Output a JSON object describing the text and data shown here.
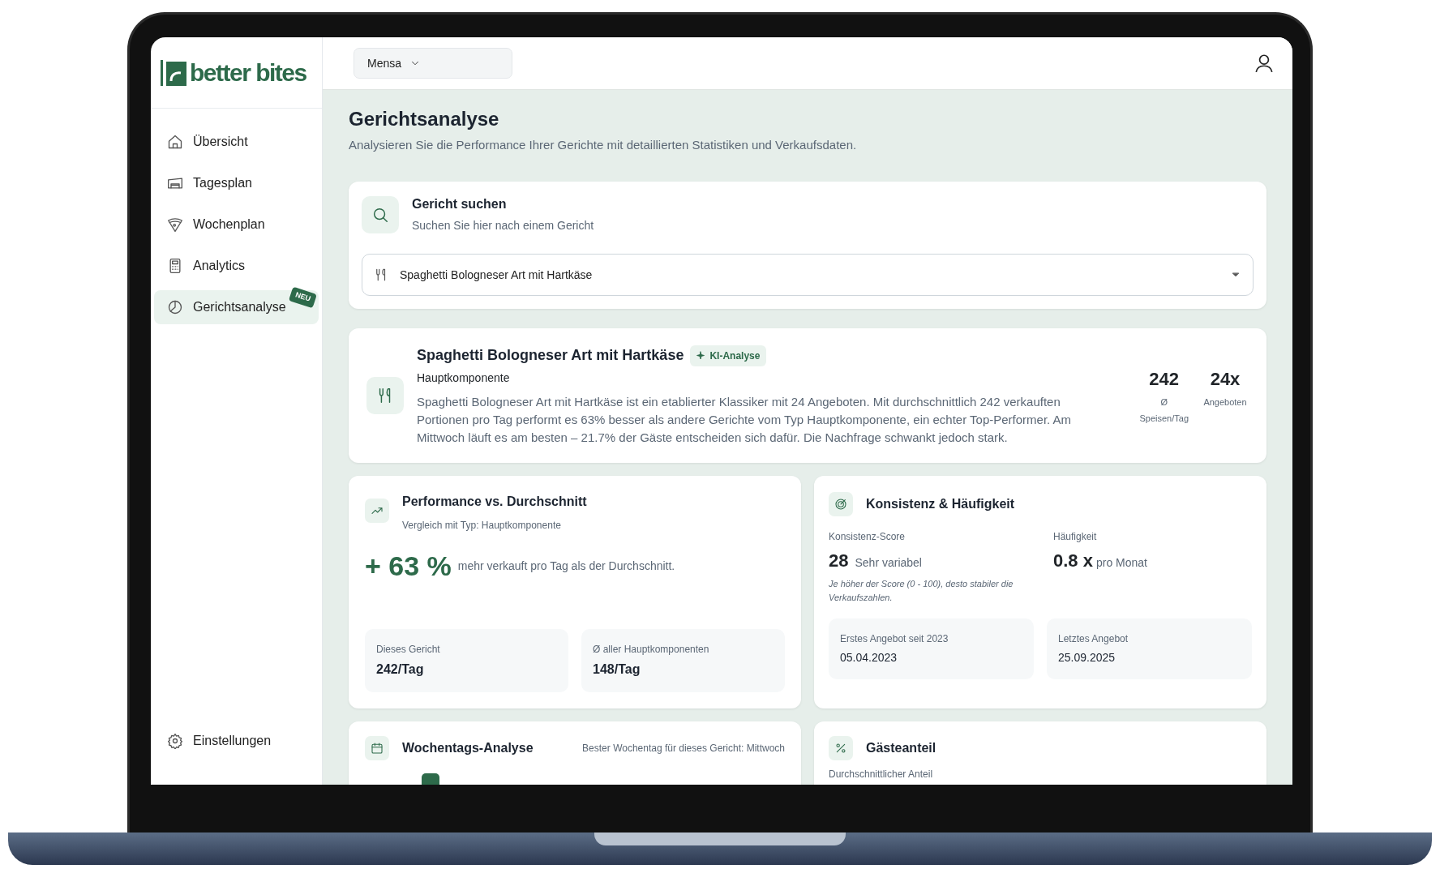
{
  "brand": {
    "name": "better bites"
  },
  "location_select": {
    "value": "Mensa"
  },
  "sidebar": {
    "items": [
      {
        "label": "Übersicht",
        "selected": false
      },
      {
        "label": "Tagesplan",
        "selected": false
      },
      {
        "label": "Wochenplan",
        "selected": false
      },
      {
        "label": "Analytics",
        "selected": false
      },
      {
        "label": "Gerichtsanalyse",
        "selected": true,
        "badge": "NEU"
      }
    ],
    "footer_item": {
      "label": "Einstellungen"
    }
  },
  "page": {
    "title": "Gerichtsanalyse",
    "subtitle": "Analysieren Sie die Performance Ihrer Gerichte mit detaillierten Statistiken und Verkaufsdaten."
  },
  "search_card": {
    "title": "Gericht suchen",
    "subtitle": "Suchen Sie hier nach einem Gericht",
    "value": "Spaghetti Bologneser Art mit Hartkäse"
  },
  "dish_card": {
    "name": "Spaghetti Bologneser Art mit Hartkäse",
    "badge": "KI-Analyse",
    "type": "Hauptkomponente",
    "description": "Spaghetti Bologneser Art mit Hartkäse ist ein etablierter Klassiker mit 24 Angeboten. Mit durchschnittlich 242 verkauften Portionen pro Tag performt es 63% besser als andere Gerichte vom Typ Hauptkomponente, ein echter Top-Performer. Am Mittwoch läuft es am besten – 21.7% der Gäste entscheiden sich dafür. Die Nachfrage schwankt jedoch stark.",
    "stats": [
      {
        "value": "242",
        "sub": "Ø",
        "label": "Speisen/Tag"
      },
      {
        "value": "24x",
        "label": "Angeboten"
      }
    ]
  },
  "performance_card": {
    "title": "Performance vs. Durchschnitt",
    "subtitle": "Vergleich mit Typ: Hauptkomponente",
    "delta": "+ 63 %",
    "delta_text": "mehr verkauft pro Tag als der Durchschnitt.",
    "boxes": [
      {
        "label": "Dieses Gericht",
        "value": "242/Tag"
      },
      {
        "label": "Ø aller Hauptkomponenten",
        "value": "148/Tag"
      }
    ]
  },
  "consistency_card": {
    "title": "Konsistenz & Häufigkeit",
    "score_label": "Konsistenz-Score",
    "score": "28",
    "score_text": "Sehr variabel",
    "note": "Je höher der Score (0 - 100), desto stabiler die Verkaufszahlen.",
    "frequency_label": "Häufigkeit",
    "frequency_value": "0.8 x",
    "frequency_unit": "pro Monat",
    "boxes": [
      {
        "label": "Erstes Angebot seit 2023",
        "value": "05.04.2023"
      },
      {
        "label": "Letztes Angebot",
        "value": "25.09.2025"
      }
    ]
  },
  "weekday_card": {
    "title": "Wochentags-Analyse",
    "best_day_text": "Bester Wochentag für dieses Gericht: Mittwoch"
  },
  "guest_card": {
    "title": "Gästeanteil",
    "subtitle": "Durchschnittlicher Anteil"
  }
}
